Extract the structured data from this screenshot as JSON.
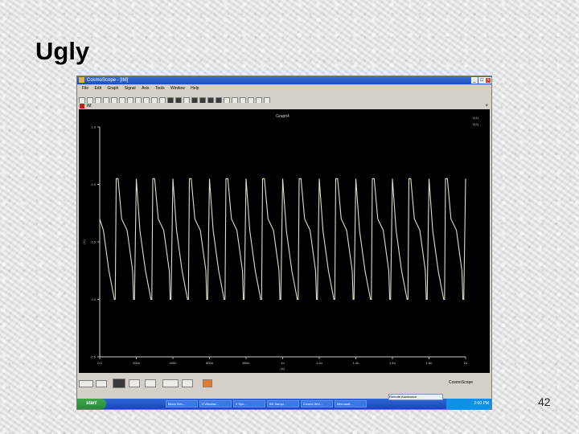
{
  "slide": {
    "title": "Ugly",
    "page_number": "42"
  },
  "app": {
    "window_title": "CosmoScope - [IM]",
    "menu": [
      "File",
      "Edit",
      "Graph",
      "Signal",
      "Axis",
      "Tools",
      "Window",
      "Help"
    ],
    "doc_tab": "IM"
  },
  "plot": {
    "title": "Graph4",
    "legend_label": "V(1)",
    "legend_sub": "V(2)",
    "xlabel": "(s)",
    "ylabel": "(V)",
    "trace_color": "#d7e3c2"
  },
  "chart_data": {
    "type": "line",
    "title": "Graph4",
    "xlabel": "(s)",
    "ylabel": "(V)",
    "x_ticks": [
      "0.0",
      "200n",
      "400n",
      "600n",
      "800n",
      "1u",
      "1.2u",
      "1.4u",
      "1.6u",
      "1.8u",
      "2u"
    ],
    "y_ticks": [
      "1.5",
      "1.0",
      "0.5",
      "0.0",
      "-0.5"
    ],
    "xlim": [
      0,
      2.0
    ],
    "ylim": [
      -0.5,
      1.5
    ],
    "x_unit": "us",
    "series": [
      {
        "name": "V(1)",
        "period_us": 0.2,
        "phase_us": 0.08,
        "high": 1.05,
        "low": 0.0,
        "rise_start_overshoot": 0.0,
        "x": [
          0.0,
          0.02,
          0.05,
          0.08,
          0.085,
          0.09,
          0.1,
          0.12,
          0.15,
          0.18,
          0.185,
          0.19,
          0.2
        ],
        "y": [
          0.7,
          0.6,
          0.25,
          0.0,
          0.0,
          1.05,
          1.05,
          0.7,
          0.6,
          0.25,
          0.0,
          0.0,
          1.05
        ]
      }
    ]
  },
  "taskbar": {
    "start_label": "start",
    "tasks": [
      "Block Sch...",
      "3 Window...",
      "2 Syn...",
      "BX Sampl...",
      "Cosmo Wel...",
      "Microsoft..."
    ],
    "clock": "2:00 PM",
    "balloon": "Remote Assistance"
  },
  "status": {
    "logo": "CosmoScope"
  }
}
